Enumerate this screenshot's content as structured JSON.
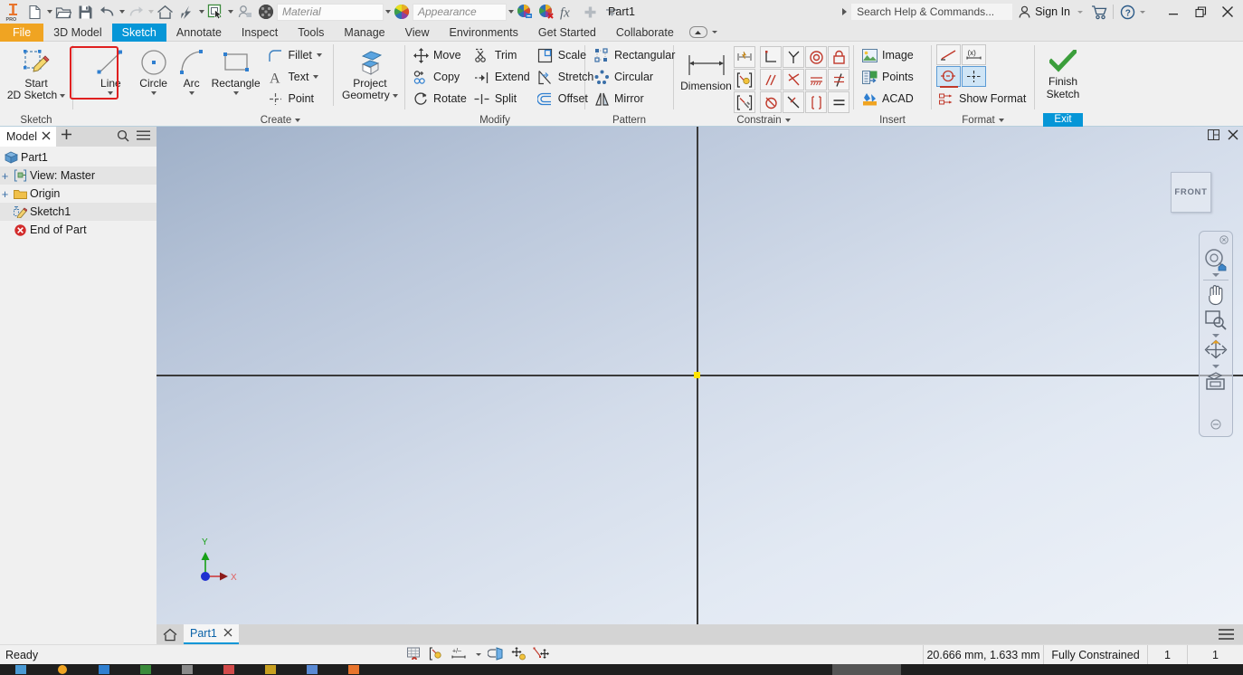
{
  "app": {
    "document_title": "Part1",
    "logo": "inventor-pro-logo"
  },
  "quick_access": {
    "items": [
      {
        "name": "new-file",
        "icon": "new-document-icon",
        "has_dropdown": true
      },
      {
        "name": "open-file",
        "icon": "open-folder-icon",
        "has_dropdown": false
      },
      {
        "name": "save",
        "icon": "save-disk-icon",
        "has_dropdown": false
      },
      {
        "name": "undo",
        "icon": "undo-arrow-icon",
        "has_dropdown": true
      },
      {
        "name": "redo",
        "icon": "redo-arrow-icon",
        "has_dropdown": true
      },
      {
        "name": "home",
        "icon": "home-icon",
        "has_dropdown": false
      },
      {
        "name": "update",
        "icon": "lightning-update-icon",
        "has_dropdown": true
      },
      {
        "name": "select",
        "icon": "select-cursor-icon",
        "has_dropdown": true
      },
      {
        "name": "return",
        "icon": "return-icon",
        "has_dropdown": false
      },
      {
        "name": "material-swatch",
        "icon": "material-sphere-icon",
        "has_dropdown": false
      }
    ],
    "material_value": "Material",
    "appearance_value": "Appearance",
    "appearance_icon": "color-wheel-icon",
    "adjust_icon": "adjust-appearance-icon",
    "clear_icon": "clear-appearance-icon",
    "fx_icon": "fx-parameters-icon",
    "plus_icon": "plus-icon",
    "more_icon": "more-dropdown-icon"
  },
  "title_right": {
    "search_placeholder": "Search Help & Commands...",
    "sign_in_label": "Sign In",
    "sign_in_icon": "person-icon",
    "cart_icon": "shopping-cart-icon",
    "help_icon": "question-circle-icon",
    "minimize": "—",
    "restore": "❐",
    "close": "✕"
  },
  "ribbon_tabs": {
    "file_label": "File",
    "items": [
      {
        "label": "3D Model",
        "active": false
      },
      {
        "label": "Sketch",
        "active": true
      },
      {
        "label": "Annotate",
        "active": false
      },
      {
        "label": "Inspect",
        "active": false
      },
      {
        "label": "Tools",
        "active": false
      },
      {
        "label": "Manage",
        "active": false
      },
      {
        "label": "View",
        "active": false
      },
      {
        "label": "Environments",
        "active": false
      },
      {
        "label": "Get Started",
        "active": false
      },
      {
        "label": "Collaborate",
        "active": false
      }
    ]
  },
  "ribbon": {
    "sketch_panel": {
      "title": "Sketch",
      "start_2d_sketch": {
        "line1": "Start",
        "line2": "2D Sketch",
        "icon": "start-2d-sketch-icon"
      }
    },
    "create_panel": {
      "title": "Create",
      "line": {
        "label": "Line",
        "icon": "line-icon",
        "highlighted": true
      },
      "circle": {
        "label": "Circle",
        "icon": "circle-icon"
      },
      "arc": {
        "label": "Arc",
        "icon": "arc-icon"
      },
      "rectangle": {
        "label": "Rectangle",
        "icon": "rectangle-icon"
      },
      "fillet": {
        "label": "Fillet",
        "icon": "fillet-icon"
      },
      "text": {
        "label": "Text",
        "icon": "text-a-icon"
      },
      "point": {
        "label": "Point",
        "icon": "point-icon"
      },
      "project_geometry": {
        "line1": "Project",
        "line2": "Geometry",
        "icon": "project-geometry-icon"
      }
    },
    "modify_panel": {
      "title": "Modify",
      "items": [
        {
          "label": "Move",
          "icon": "move-icon"
        },
        {
          "label": "Trim",
          "icon": "trim-icon"
        },
        {
          "label": "Scale",
          "icon": "scale-icon"
        },
        {
          "label": "Copy",
          "icon": "copy-icon"
        },
        {
          "label": "Extend",
          "icon": "extend-icon"
        },
        {
          "label": "Stretch",
          "icon": "stretch-icon"
        },
        {
          "label": "Rotate",
          "icon": "rotate-icon"
        },
        {
          "label": "Split",
          "icon": "split-icon"
        },
        {
          "label": "Offset",
          "icon": "offset-icon"
        }
      ]
    },
    "pattern_panel": {
      "title": "Pattern",
      "items": [
        {
          "label": "Rectangular",
          "icon": "rectangular-pattern-icon"
        },
        {
          "label": "Circular",
          "icon": "circular-pattern-icon"
        },
        {
          "label": "Mirror",
          "icon": "mirror-icon"
        }
      ]
    },
    "constrain_panel": {
      "title": "Constrain",
      "dimension_label": "Dimension",
      "dimension_icon": "dimension-icon",
      "left_buttons": [
        {
          "name": "auto-dimension-icon"
        },
        {
          "name": "show-constraints-icon"
        },
        {
          "name": "constraint-settings-icon"
        }
      ],
      "grid": [
        {
          "name": "perpendicular-constraint-icon"
        },
        {
          "name": "coincident-constraint-icon"
        },
        {
          "name": "concentric-constraint-icon"
        },
        {
          "name": "fix-constraint-icon"
        },
        {
          "name": "parallel-constraint-icon"
        },
        {
          "name": "tangent-constraint-icon"
        },
        {
          "name": "collinear-constraint-icon"
        },
        {
          "name": "equal-constraint-icon"
        },
        {
          "name": "smooth-constraint-icon"
        },
        {
          "name": "symmetric-constraint-icon"
        },
        {
          "name": "horizontal-constraint-icon"
        },
        {
          "name": "vertical-constraint-icon"
        }
      ]
    },
    "insert_panel": {
      "title": "Insert",
      "items": [
        {
          "label": "Image",
          "icon": "image-icon"
        },
        {
          "label": "Points",
          "icon": "points-import-icon"
        },
        {
          "label": "ACAD",
          "icon": "acad-import-icon"
        }
      ]
    },
    "format_panel": {
      "title": "Format",
      "show_format_label": "Show Format",
      "show_format_icon": "show-format-icon",
      "buttons": [
        {
          "name": "construction-line-icon",
          "on": false
        },
        {
          "name": "driven-dimension-icon",
          "on": false
        },
        {
          "name": "centerline-icon",
          "on": true
        },
        {
          "name": "center-point-icon",
          "on": true
        }
      ]
    },
    "exit_panel": {
      "finish_line1": "Finish",
      "finish_line2": "Sketch",
      "finish_icon": "green-checkmark-icon",
      "exit_label": "Exit"
    }
  },
  "browser": {
    "tab_label": "Model",
    "close_icon": "close-icon",
    "add_icon": "plus-icon",
    "search_icon": "search-icon",
    "menu_icon": "hamburger-menu-icon",
    "tree": [
      {
        "label": "Part1",
        "icon": "part-cube-icon",
        "indent": 0,
        "expander": ""
      },
      {
        "label": "View: Master",
        "icon": "view-master-icon",
        "indent": 1,
        "expander": "+"
      },
      {
        "label": "Origin",
        "icon": "folder-icon",
        "indent": 1,
        "expander": "+"
      },
      {
        "label": "Sketch1",
        "icon": "sketch-icon",
        "indent": 1,
        "expander": ""
      },
      {
        "label": "End of Part",
        "icon": "end-of-part-icon",
        "indent": 1,
        "expander": ""
      }
    ]
  },
  "canvas": {
    "viewcube_label": "FRONT",
    "panel_icon": "split-view-icon",
    "close_icon": "close-icon",
    "axis_labels": {
      "x": "X",
      "y": "Y"
    },
    "nav_tools": [
      {
        "name": "steering-wheel-home-icon"
      },
      {
        "name": "pan-hand-icon"
      },
      {
        "name": "zoom-window-icon"
      },
      {
        "name": "orbit-icon"
      },
      {
        "name": "look-at-icon"
      }
    ]
  },
  "doc_tabs": {
    "home_icon": "home-icon",
    "tabs": [
      {
        "label": "Part1",
        "close": "✕",
        "active": true
      }
    ],
    "menu_icon": "hamburger-menu-icon"
  },
  "status_bar": {
    "message": "Ready",
    "tools": [
      {
        "name": "grid-snap-icon"
      },
      {
        "name": "constraint-display-icon"
      },
      {
        "name": "dimension-display-icon"
      },
      {
        "name": "slice-graphics-icon"
      },
      {
        "name": "show-all-constraints-icon"
      },
      {
        "name": "hide-all-constraints-icon"
      }
    ],
    "coordinates": "20.666 mm, 1.633 mm",
    "constraint_status": "Fully Constrained",
    "value_1": "1",
    "value_2": "1"
  },
  "colors": {
    "accent_blue": "#0696d7",
    "file_orange": "#f0a422",
    "highlight_red": "#e02020",
    "origin_yellow": "#ffe400",
    "canvas_top": "#9fb0c8",
    "canvas_bottom": "#eef2f8"
  }
}
